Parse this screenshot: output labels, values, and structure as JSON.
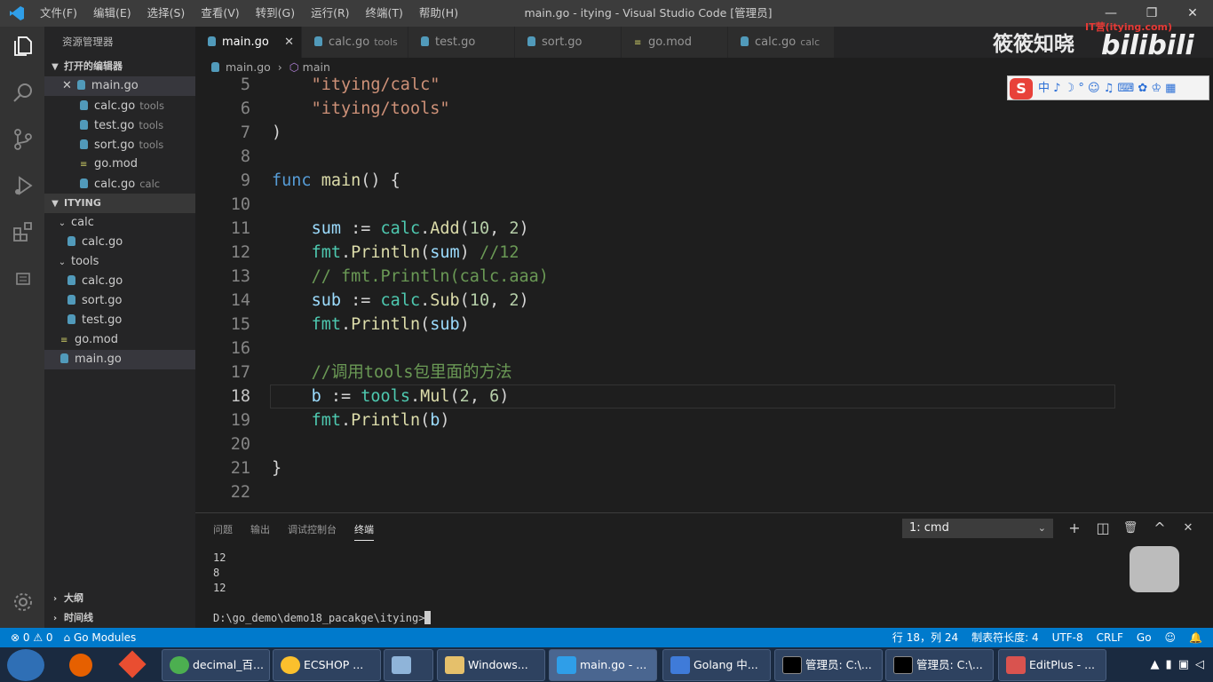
{
  "titlebar": {
    "menu": [
      "文件(F)",
      "编辑(E)",
      "选择(S)",
      "查看(V)",
      "转到(G)",
      "运行(R)",
      "终端(T)",
      "帮助(H)"
    ],
    "title": "main.go - itying - Visual Studio Code [管理员]",
    "minimize": "—",
    "maximize": "❐",
    "close": "✕"
  },
  "sidebar": {
    "header": "资源管理器",
    "open_editors_label": "打开的编辑器",
    "open_editors": [
      {
        "name": "main.go",
        "desc": "",
        "close": "✕"
      },
      {
        "name": "calc.go",
        "desc": "tools"
      },
      {
        "name": "test.go",
        "desc": "tools"
      },
      {
        "name": "sort.go",
        "desc": "tools"
      },
      {
        "name": "go.mod",
        "desc": ""
      },
      {
        "name": "calc.go",
        "desc": "calc"
      }
    ],
    "project_label": "ITYING",
    "tree": {
      "calc": "calc",
      "calc_file": "calc.go",
      "tools": "tools",
      "tools_files": [
        "calc.go",
        "sort.go",
        "test.go"
      ],
      "gomod": "go.mod",
      "main": "main.go"
    },
    "outline": "大纲",
    "timeline": "时间线"
  },
  "tabs": [
    {
      "name": "main.go",
      "desc": "",
      "close": "✕"
    },
    {
      "name": "calc.go",
      "desc": "tools"
    },
    {
      "name": "test.go",
      "desc": ""
    },
    {
      "name": "sort.go",
      "desc": ""
    },
    {
      "name": "go.mod",
      "desc": ""
    },
    {
      "name": "calc.go",
      "desc": "calc"
    }
  ],
  "breadcrumb": {
    "file": "main.go",
    "sep": "›",
    "symbol": "main"
  },
  "code": {
    "line_numbers": [
      "5",
      "6",
      "7",
      "8",
      "9",
      "10",
      "11",
      "12",
      "13",
      "14",
      "15",
      "16",
      "17",
      "18",
      "19",
      "20",
      "21",
      "22"
    ]
  },
  "overlay": {
    "watermark": "筱筱知晓",
    "site": "IT营(itying.com)",
    "bili": "bilibili",
    "ime_s": "S",
    "ime_items": "中 ♪ ☽ ° ☺ ♫ ⌨ ✿ ♔ ▦"
  },
  "panel": {
    "tabs": [
      "问题",
      "输出",
      "调试控制台",
      "终端"
    ],
    "terminal_select": "1: cmd",
    "add": "+",
    "split": "◫",
    "trash": "🗑",
    "up": "^",
    "close": "✕",
    "output": [
      "12",
      "8",
      "12"
    ],
    "prompt": "D:\\go_demo\\demo18_pacakge\\itying>"
  },
  "statusbar": {
    "errors": "⊗ 0 ⚠ 0",
    "gomodules": "Go Modules",
    "position": "行 18，列 24",
    "tabsize": "制表符长度: 4",
    "encoding": "UTF-8",
    "eol": "CRLF",
    "lang": "Go"
  },
  "taskbar": {
    "windows": [
      "decimal_百...",
      "ECSHOP ...",
      "",
      "Windows...",
      "main.go - ...",
      "Golang 中...",
      "管理员: C:\\...",
      "管理员: C:\\...",
      "EditPlus - ..."
    ]
  }
}
